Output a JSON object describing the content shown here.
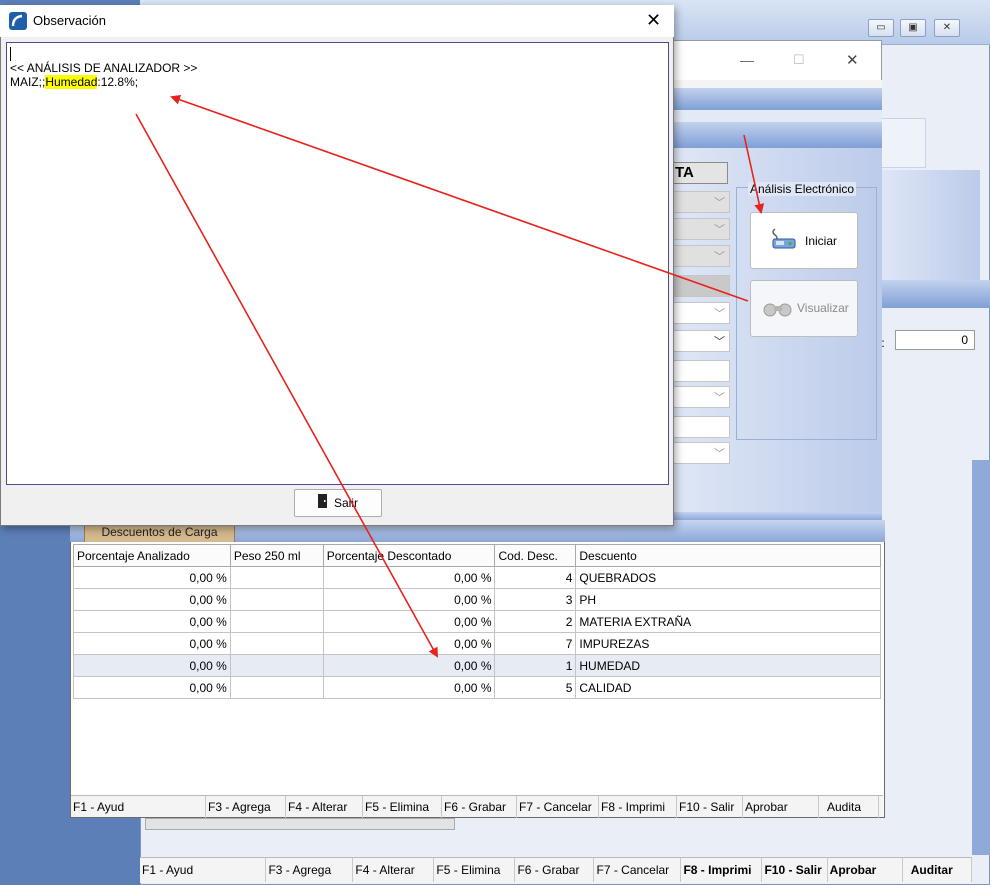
{
  "dialog": {
    "title": "Observación",
    "close_label": "✕",
    "text_lines": [
      "",
      "<< ANÁLISIS DE ANALIZADOR >>"
    ],
    "line3_prefix": "MAIZ;;",
    "line3_highlight": "Humedad",
    "line3_suffix": ":12.8%;",
    "salir_label": "Salir"
  },
  "background_window": {
    "min_label": "▭",
    "max_label": "▣",
    "close_label": "✕",
    "counter_value": "0",
    "counter_label": ".:"
  },
  "middle_window": {
    "min_label": "—",
    "max_label": "☐",
    "close_label": "✕",
    "header_fragment": "TA"
  },
  "analisis": {
    "group_label": "Análisis Electrónico",
    "iniciar_label": "Iniciar",
    "visualizar_label": "Visualizar"
  },
  "grid": {
    "tab_label": "Descuentos de Carga",
    "columns": [
      "Porcentaje Analizado",
      "Peso 250 ml",
      "Porcentaje Descontado",
      "Cod. Desc.",
      "Descuento"
    ],
    "rows": [
      [
        "0,00 %",
        "",
        "0,00 %",
        "4",
        "QUEBRADOS"
      ],
      [
        "0,00 %",
        "",
        "0,00 %",
        "3",
        "PH"
      ],
      [
        "0,00 %",
        "",
        "0,00 %",
        "2",
        "MATERIA EXTRAÑA"
      ],
      [
        "0,00 %",
        "",
        "0,00 %",
        "7",
        "IMPUREZAS"
      ],
      [
        "0,00 %",
        "",
        "0,00 %",
        "1",
        "HUMEDAD"
      ],
      [
        "0,00 %",
        "",
        "0,00 %",
        "5",
        "CALIDAD"
      ]
    ]
  },
  "status_inner": [
    "F1 - Ayud",
    "F3 - Agrega",
    "F4 - Alterar",
    "F5 - Elimina",
    "F6 - Grabar",
    "F7 - Cancelar",
    "F8 - Imprimi",
    "F10 - Salir",
    "Aprobar",
    "Audita"
  ],
  "status_outer": [
    "F1 - Ayud",
    "F3 - Agrega",
    "F4 - Alterar",
    "F5 - Elimina",
    "F6 - Grabar",
    "F7 - Cancelar",
    "F8 - Imprimi",
    "F10 - Salir",
    "Aprobar",
    "Auditar"
  ],
  "colors": {
    "arrow": "#e8221c",
    "highlight": "#ffff00",
    "accent_blue": "#7f9fd6"
  }
}
